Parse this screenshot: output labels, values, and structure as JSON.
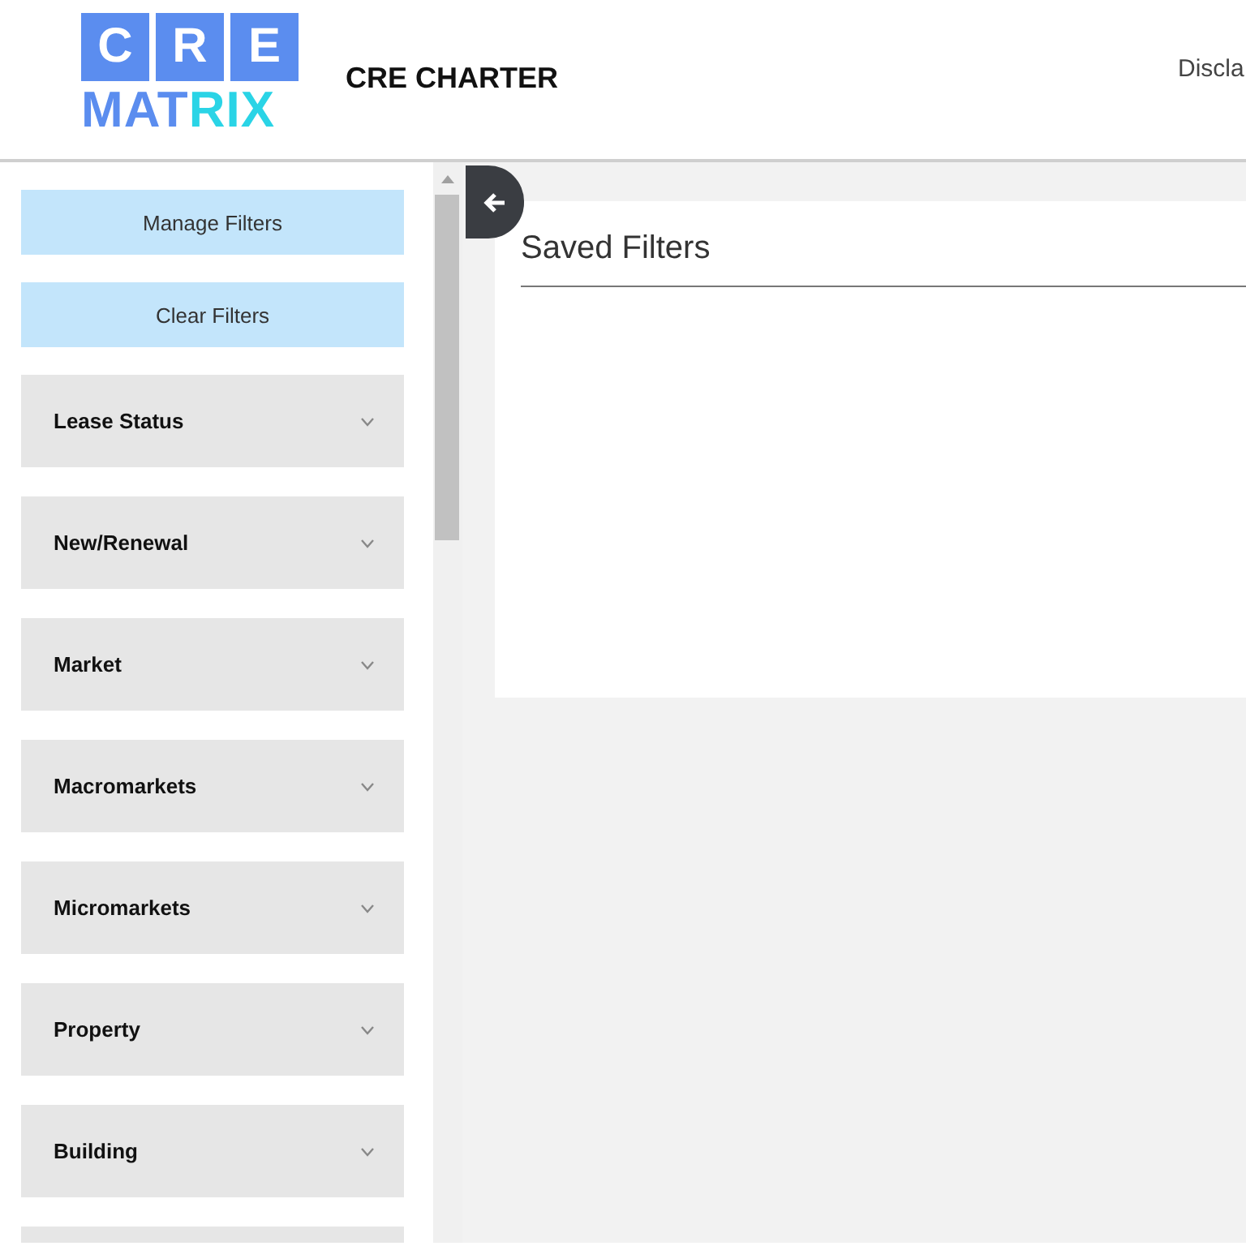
{
  "header": {
    "logo": {
      "letters": [
        "C",
        "R",
        "E"
      ],
      "word_parts": [
        "MAT",
        "RIX"
      ]
    },
    "title": "CRE CHARTER",
    "nav_link": "Discla"
  },
  "sidebar": {
    "buttons": [
      "Manage Filters",
      "Clear Filters"
    ],
    "filters": [
      {
        "label": "Lease Status",
        "expanded": false
      },
      {
        "label": "New/Renewal",
        "expanded": false
      },
      {
        "label": "Market",
        "expanded": false
      },
      {
        "label": "Macromarkets",
        "expanded": false
      },
      {
        "label": "Micromarkets",
        "expanded": false
      },
      {
        "label": "Property",
        "expanded": false
      },
      {
        "label": "Building",
        "expanded": false
      }
    ]
  },
  "saved_filters": {
    "title": "Saved Filters"
  }
}
